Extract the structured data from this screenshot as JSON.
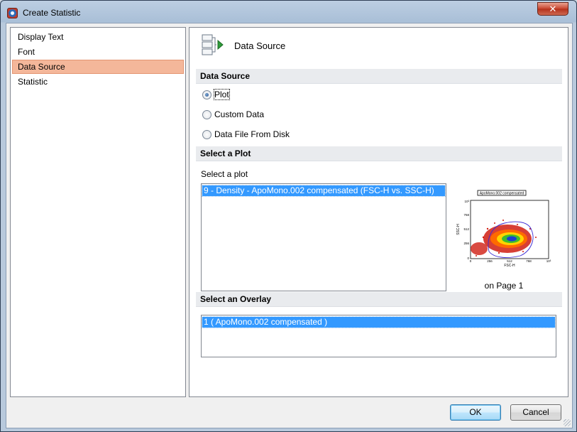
{
  "window": {
    "title": "Create Statistic",
    "close_glyph": "✕"
  },
  "nav": {
    "items": [
      {
        "label": "Display Text",
        "selected": false
      },
      {
        "label": "Font",
        "selected": false
      },
      {
        "label": "Data Source",
        "selected": true
      },
      {
        "label": "Statistic",
        "selected": false
      }
    ]
  },
  "content": {
    "header_title": "Data Source",
    "header_icon": "data-source-icon",
    "data_source": {
      "section_title": "Data Source",
      "options": [
        {
          "label": "Plot",
          "checked": true
        },
        {
          "label": "Custom Data",
          "checked": false
        },
        {
          "label": "Data File From Disk",
          "checked": false
        }
      ]
    },
    "select_plot": {
      "section_title": "Select a Plot",
      "prompt": "Select a plot",
      "items": [
        "9 - Density - ApoMono.002 compensated (FSC-H vs. SSC-H)"
      ],
      "preview": {
        "title": "ApoMono.002 compensated",
        "xlabel": "FSC-H",
        "ylabel": "SSC-H",
        "x_ticks": [
          "0",
          "256",
          "512",
          "768",
          "10³"
        ],
        "y_ticks": [
          "10³",
          "768",
          "512",
          "256",
          "0"
        ],
        "caption": "on Page 1"
      }
    },
    "select_overlay": {
      "section_title": "Select an Overlay",
      "items": [
        "1 ( ApoMono.002 compensated )"
      ]
    }
  },
  "buttons": {
    "ok": "OK",
    "cancel": "Cancel"
  },
  "colors": {
    "nav_selected": "#f4b79a",
    "list_selected": "#3399ff",
    "close_button": "#c7422c"
  }
}
